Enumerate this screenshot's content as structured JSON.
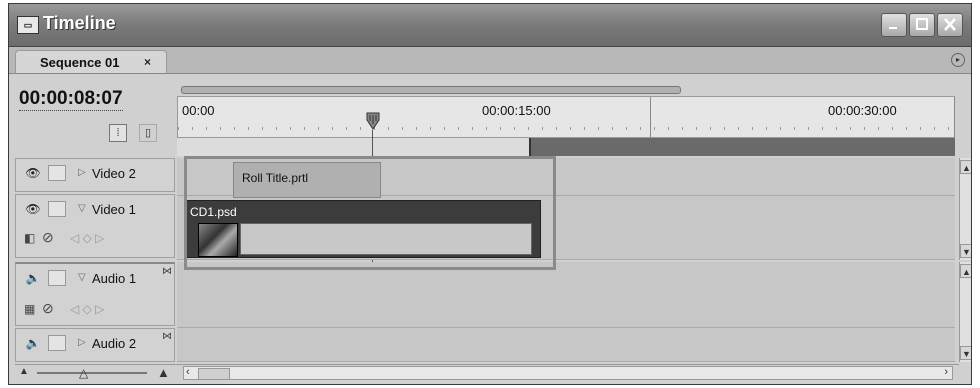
{
  "window": {
    "title": "Timeline"
  },
  "tabs": [
    {
      "label": "Sequence 01",
      "close": "×"
    }
  ],
  "timecode": "00:00:08:07",
  "ruler": {
    "ticks": [
      "00:00",
      "00:00:15:00",
      "00:00:30:00"
    ]
  },
  "tracks": {
    "video2": {
      "label": "Video 2"
    },
    "video1": {
      "label": "Video 1"
    },
    "audio1": {
      "label": "Audio 1"
    },
    "audio2": {
      "label": "Audio 2"
    }
  },
  "clips": {
    "title_clip": "Roll Title.prtl",
    "video_clip": "CD1.psd"
  }
}
